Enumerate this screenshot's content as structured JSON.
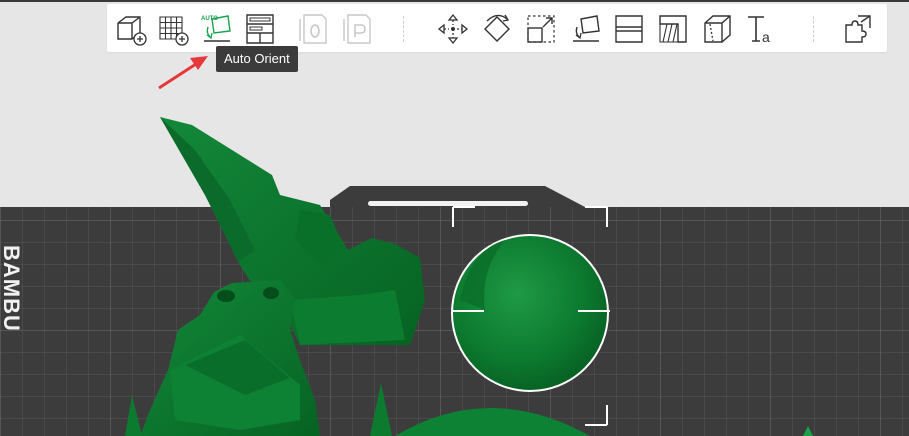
{
  "toolbar": {
    "tools": [
      {
        "id": "add-part",
        "icon": "cube-plus-icon"
      },
      {
        "id": "add-plate",
        "icon": "grid-plus-icon"
      },
      {
        "id": "auto-orient",
        "icon": "auto-orient-icon",
        "badge": "AUTO"
      },
      {
        "id": "arrange",
        "icon": "arrange-icon"
      },
      {
        "id": "split-objects",
        "icon": "split-objects-icon",
        "badge": "O"
      },
      {
        "id": "split-parts",
        "icon": "split-parts-icon",
        "badge": "P"
      },
      {
        "id": "move",
        "icon": "move-icon"
      },
      {
        "id": "rotate",
        "icon": "rotate-icon"
      },
      {
        "id": "scale",
        "icon": "scale-icon"
      },
      {
        "id": "lay-on-face",
        "icon": "lay-on-face-icon"
      },
      {
        "id": "cut",
        "icon": "cut-icon"
      },
      {
        "id": "support-paint",
        "icon": "support-paint-icon"
      },
      {
        "id": "seam-paint",
        "icon": "seam-paint-icon"
      },
      {
        "id": "text-shape",
        "icon": "text-shape-icon",
        "badge": "Ta"
      },
      {
        "id": "assembly",
        "icon": "puzzle-icon"
      }
    ]
  },
  "tooltip": {
    "text": "Auto Orient"
  },
  "plate": {
    "brand_text": "BAMBU"
  },
  "colors": {
    "background": "#e6e6e6",
    "plate": "#3e3e3e",
    "grid": "#5a5a5a",
    "model": "#0e7a32",
    "model_dark": "#075a22",
    "accent": "#16a34a",
    "arrow": "#e5383b",
    "tooltip_bg": "#3b3b3b"
  }
}
